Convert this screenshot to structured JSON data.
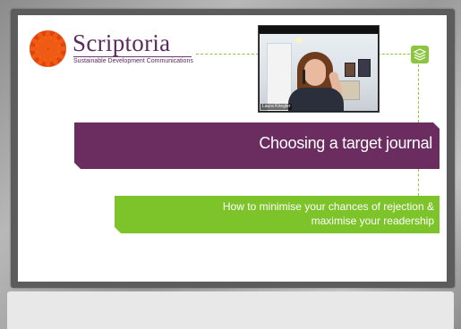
{
  "slide": {
    "brand": "Scriptoria",
    "tagline": "Sustainable Development Communications",
    "title": "Choosing a target journal",
    "subtitle_line1": "How to minimise your chances of rejection &",
    "subtitle_line2": "maximise your readership",
    "accent_purple": "#6b2c60",
    "accent_green": "#7dc42a",
    "logo_icon": "gerbera-flower-icon",
    "corner_icon": "layers-icon"
  },
  "video": {
    "participant_name": "Laura Kriegler"
  }
}
